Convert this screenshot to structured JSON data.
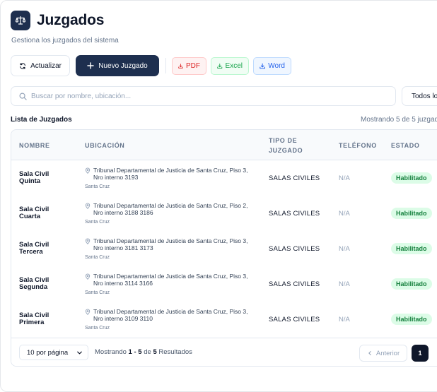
{
  "page": {
    "title": "Juzgados",
    "subtitle": "Gestiona los juzgados del sistema"
  },
  "toolbar": {
    "refresh_label": "Actualizar",
    "new_label": "Nuevo Juzgado",
    "pdf_label": "PDF",
    "excel_label": "Excel",
    "word_label": "Word"
  },
  "search": {
    "placeholder": "Buscar por nombre, ubicación..."
  },
  "filter": {
    "label": "Todos lo"
  },
  "list": {
    "title": "Lista de Juzgados",
    "showing": "Mostrando 5 de 5 juzgad"
  },
  "table": {
    "columns": {
      "nombre": "NOMBRE",
      "ubicacion": "UBICACIÓN",
      "tipo_line1": "TIPO DE",
      "tipo_line2": "JUZGADO",
      "telefono": "TELÉFONO",
      "estado": "ESTADO"
    },
    "rows": [
      {
        "name1": "Sala Civil",
        "name2": "Quinta",
        "loc1": "Tribunal Departamental de Justicia de Santa Cruz, Piso 3,",
        "loc2": "Nro interno 3193",
        "city": "Santa Cruz",
        "tipo": "SALAS CIVILES",
        "telefono": "N/A",
        "estado": "Habilitado"
      },
      {
        "name1": "Sala Civil",
        "name2": "Cuarta",
        "loc1": "Tribunal Departamental de Justicia de Santa Cruz, Piso 2,",
        "loc2": "Nro interno 3188 3186",
        "city": "Santa Cruz",
        "tipo": "SALAS CIVILES",
        "telefono": "N/A",
        "estado": "Habilitado"
      },
      {
        "name1": "Sala Civil",
        "name2": "Tercera",
        "loc1": "Tribunal Departamental de Justicia de Santa Cruz, Piso 3,",
        "loc2": "Nro interno 3181 3173",
        "city": "Santa Cruz",
        "tipo": "SALAS CIVILES",
        "telefono": "N/A",
        "estado": "Habilitado"
      },
      {
        "name1": "Sala Civil",
        "name2": "Segunda",
        "loc1": "Tribunal Departamental de Justicia de Santa Cruz, Piso 3,",
        "loc2": "Nro interno 3114 3166",
        "city": "Santa Cruz",
        "tipo": "SALAS CIVILES",
        "telefono": "N/A",
        "estado": "Habilitado"
      },
      {
        "name1": "Sala Civil",
        "name2": "Primera",
        "loc1": "Tribunal Departamental de Justicia de Santa Cruz, Piso 3,",
        "loc2": "Nro interno 3109 3110",
        "city": "Santa Cruz",
        "tipo": "SALAS CIVILES",
        "telefono": "N/A",
        "estado": "Habilitado"
      }
    ]
  },
  "pagination": {
    "per_page": "10 por página",
    "results_prefix": "Mostrando",
    "range_start": "1",
    "range_sep": "-",
    "range_end": "5",
    "of_word": "de",
    "total": "5",
    "results_word": "Resultados",
    "prev_label": "Anterior",
    "current_page": "1"
  },
  "colors": {
    "primary": "#1e2f4f",
    "badge_bg": "#dcfce7",
    "badge_text": "#15803d",
    "pdf": "#dc2626",
    "excel": "#16a34a",
    "word": "#2563eb"
  },
  "icons": {
    "logo": "scales-icon",
    "refresh": "refresh-icon",
    "new": "plus-icon",
    "pdf": "download-icon",
    "excel": "download-icon",
    "word": "download-icon",
    "search": "search-icon",
    "location": "map-pin-icon",
    "per_page": "chevron-down-icon",
    "prev": "chevron-left-icon"
  }
}
